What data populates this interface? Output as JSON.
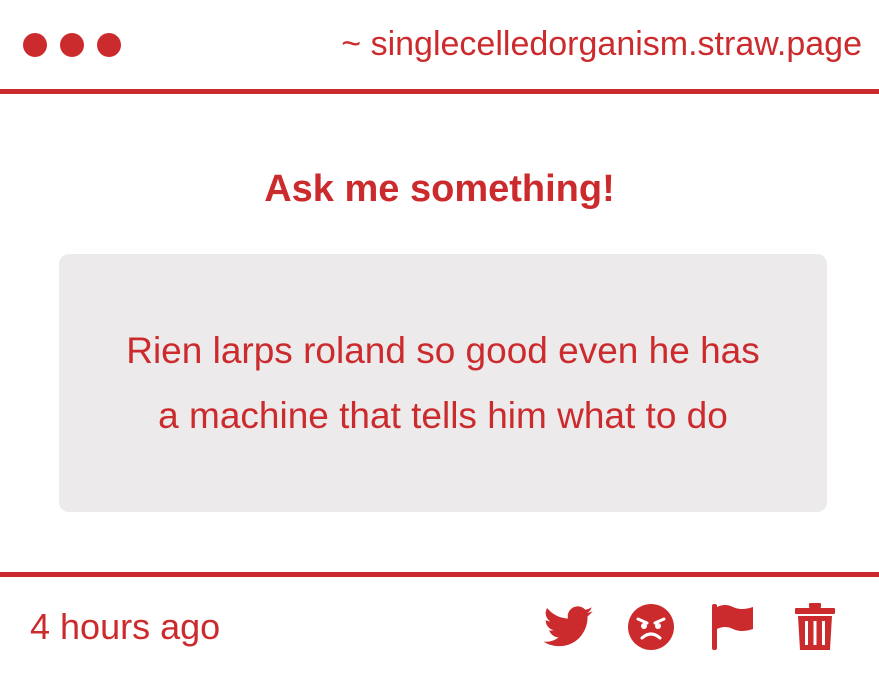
{
  "window": {
    "url": "~ singlecelledorganism.straw.page"
  },
  "main": {
    "heading": "Ask me something!",
    "question": "Rien larps roland so good even he has a machine that tells him what to do"
  },
  "footer": {
    "timestamp": "4 hours ago",
    "actions": [
      {
        "icon": "twitter-icon"
      },
      {
        "icon": "angry-face-icon"
      },
      {
        "icon": "flag-icon"
      },
      {
        "icon": "trash-icon"
      }
    ]
  },
  "colors": {
    "accent": "#cc2b2e",
    "box_background": "#eceaeb",
    "background": "#ffffff"
  }
}
